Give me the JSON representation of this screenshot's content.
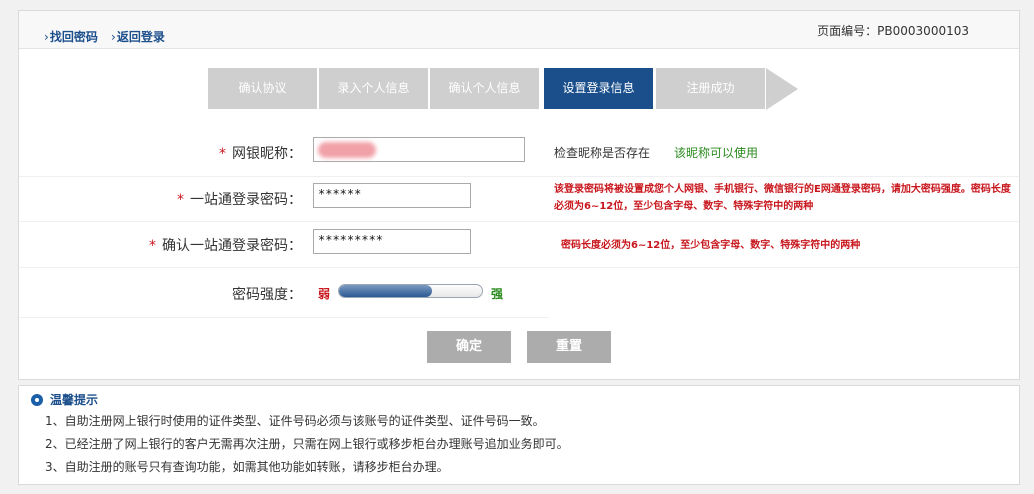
{
  "header": {
    "link_find_password": "找回密码",
    "link_back_login": "返回登录",
    "page_code": "页面编号：PB0003000103"
  },
  "steps": [
    {
      "label": "确认协议",
      "active": false
    },
    {
      "label": "录入个人信息",
      "active": false
    },
    {
      "label": "确认个人信息",
      "active": false
    },
    {
      "label": "设置登录信息",
      "active": true
    },
    {
      "label": "注册成功",
      "active": false
    }
  ],
  "form": {
    "nickname": {
      "required_mark": "*",
      "label": "网银昵称：",
      "check_text": "检查昵称是否存在",
      "check_result": "该昵称可以使用"
    },
    "password": {
      "required_mark": "*",
      "label": "一站通登录密码：",
      "value": "******",
      "hint": "该登录密码将被设置成您个人网银、手机银行、微信银行的E网通登录密码，请加大密码强度。密码长度必须为6~12位，至少包含字母、数字、特殊字符中的两种"
    },
    "confirm_password": {
      "required_mark": "*",
      "label": "确认一站通登录密码：",
      "value": "*********",
      "hint": "密码长度必须为6~12位，至少包含字母、数字、特殊字符中的两种"
    },
    "strength": {
      "label": "密码强度：",
      "weak_label": "弱",
      "strong_label": "强",
      "level_percent": 65
    },
    "confirm_button": "确定",
    "reset_button": "重置"
  },
  "tips": {
    "title": "温馨提示",
    "items": [
      "1、自助注册网上银行时使用的证件类型、证件号码必须与该账号的证件类型、证件号码一致。",
      "2、已经注册了网上银行的客户无需再次注册，只需在网上银行或移步柜台办理账号追加业务即可。",
      "3、自助注册的账号只有查询功能，如需其他功能如转账，请移步柜台办理。"
    ]
  },
  "colors": {
    "accent": "#1a4f8c",
    "step_inactive": "#cfcfcf",
    "required": "#c8161d",
    "success": "#2a8a1d",
    "button": "#acacac"
  }
}
